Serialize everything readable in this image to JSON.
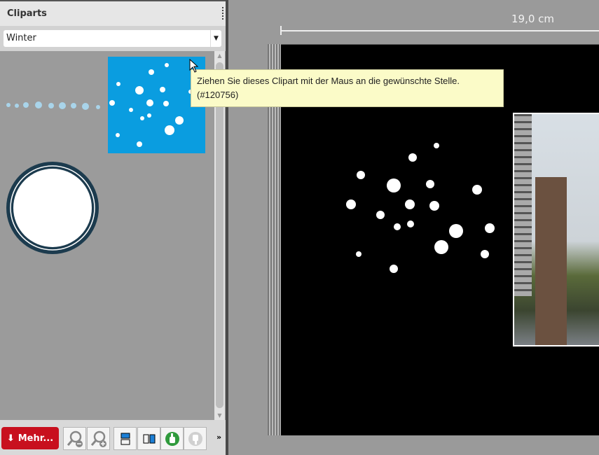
{
  "panel": {
    "title": "Cliparts",
    "category": "Winter"
  },
  "toolbar": {
    "more_label": "Mehr..."
  },
  "canvas": {
    "ruler_label": "19,0 cm"
  },
  "tooltip": {
    "line1": "Ziehen Sie dieses Clipart mit der Maus an die gewünschte Stelle.",
    "line2": "(#120756)"
  },
  "colors": {
    "accent": "#c8101e",
    "clipart_blue": "#0a9de0",
    "tooltip_bg": "#fbfbc8"
  }
}
